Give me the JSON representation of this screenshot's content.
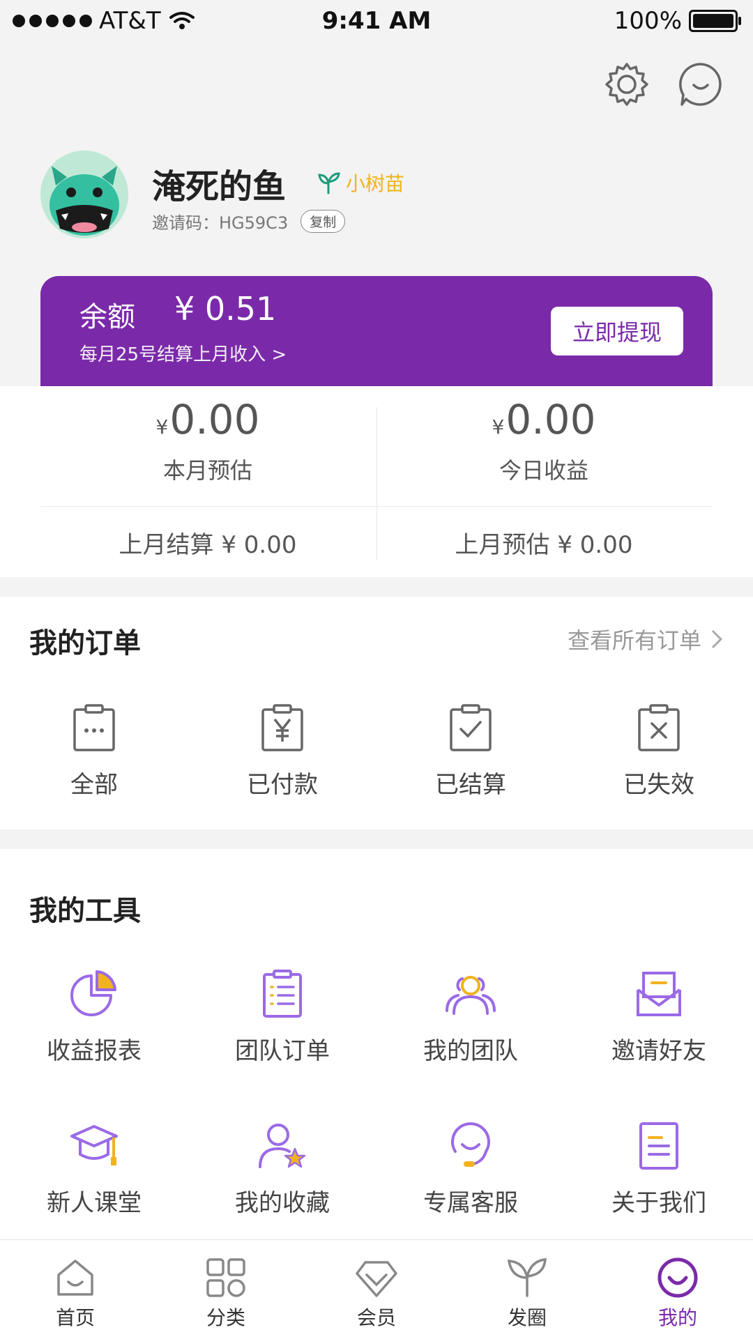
{
  "status": {
    "carrier": "AT&T",
    "time": "9:41 AM",
    "battery": "100%"
  },
  "profile": {
    "name": "淹死的鱼",
    "level": "小树苗",
    "invite_label": "邀请码：HG59C3",
    "copy_label": "复制"
  },
  "balance": {
    "label": "余额",
    "value": "¥ 0.51",
    "note": "每月25号结算上月收入 >",
    "withdraw": "立即提现"
  },
  "earnings": {
    "month_est": {
      "currency": "¥",
      "amount": "0.00",
      "label": "本月预估"
    },
    "today": {
      "currency": "¥",
      "amount": "0.00",
      "label": "今日收益"
    },
    "last_settled": "上月结算 ¥ 0.00",
    "last_est": "上月预估 ¥ 0.00"
  },
  "orders": {
    "title": "我的订单",
    "view_all": "查看所有订单",
    "items": [
      {
        "label": "全部",
        "icon": "clipboard-dots-icon"
      },
      {
        "label": "已付款",
        "icon": "clipboard-yen-icon"
      },
      {
        "label": "已结算",
        "icon": "clipboard-check-icon"
      },
      {
        "label": "已失效",
        "icon": "clipboard-x-icon"
      }
    ]
  },
  "tools": {
    "title": "我的工具",
    "items": [
      {
        "label": "收益报表",
        "icon": "pie-chart-icon"
      },
      {
        "label": "团队订单",
        "icon": "clipboard-list-icon"
      },
      {
        "label": "我的团队",
        "icon": "team-icon"
      },
      {
        "label": "邀请好友",
        "icon": "envelope-icon"
      },
      {
        "label": "新人课堂",
        "icon": "graduation-cap-icon"
      },
      {
        "label": "我的收藏",
        "icon": "user-star-icon"
      },
      {
        "label": "专属客服",
        "icon": "headset-icon"
      },
      {
        "label": "关于我们",
        "icon": "document-icon"
      }
    ]
  },
  "tabbar": {
    "items": [
      {
        "label": "首页",
        "icon": "home-icon"
      },
      {
        "label": "分类",
        "icon": "grid-icon"
      },
      {
        "label": "会员",
        "icon": "diamond-icon"
      },
      {
        "label": "发圈",
        "icon": "sprout-icon"
      },
      {
        "label": "我的",
        "icon": "smile-icon"
      }
    ],
    "active": "我的"
  },
  "colors": {
    "accent": "#7a2aa9",
    "tool_purple": "#9b6ae6",
    "tool_yellow": "#f2b21e",
    "level_yellow": "#f2b21e"
  }
}
